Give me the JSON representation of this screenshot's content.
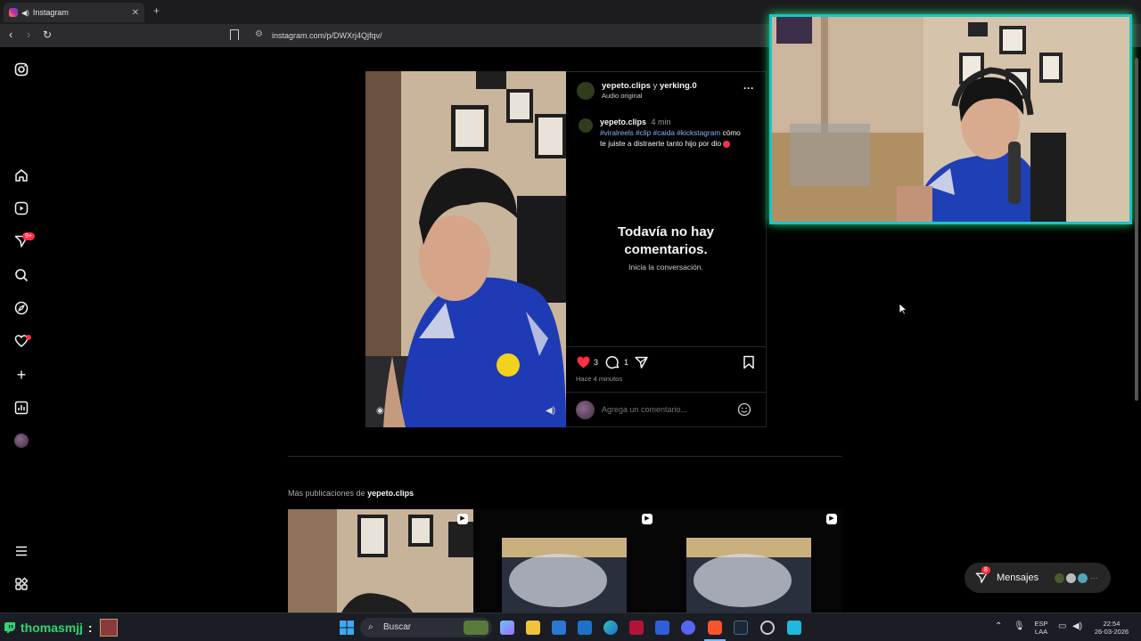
{
  "browser": {
    "tab_title": "Instagram",
    "url": "instagram.com/p/DWXrj4Qjfqv/"
  },
  "sidebar": {
    "notifications_badge": "9+"
  },
  "post": {
    "header_user": "yepeto.clips",
    "header_connector": "y",
    "header_collab": "yerking.0",
    "audio": "Audio original",
    "caption_user": "yepeto.clips",
    "caption_time": "4 min",
    "caption_tags": "#viralreels #clip #caida #kickstagram",
    "caption_text_1": "cómo",
    "caption_text_2": "te juiste a distraerte tanto hijo por dio",
    "no_comments_title_1": "Todavía no hay",
    "no_comments_title_2": "comentarios.",
    "no_comments_sub": "Inicia la conversación.",
    "likes": "3",
    "comments": "1",
    "timestamp": "Hace 4 minutos",
    "comment_placeholder": "Agrega un comentario...",
    "more_label": "···"
  },
  "more_posts": {
    "label": "Más publicaciones de",
    "user": "yepeto.clips"
  },
  "messages": {
    "label": "Mensajes",
    "badge": "8"
  },
  "stream_overlay": {
    "username": "thomasmjj",
    "suffix": ":"
  },
  "taskbar": {
    "search_label": "Buscar",
    "lang_1": "ESP",
    "lang_2": "LAA",
    "time": "22:54",
    "date": "26-03-2026"
  },
  "colors": {
    "like_red": "#ff3040",
    "hashtag_blue": "#8fb1ff",
    "overlay_cyan": "#17c6c9",
    "overlay_green": "#22e07a",
    "twitch_green": "#2ed573"
  }
}
